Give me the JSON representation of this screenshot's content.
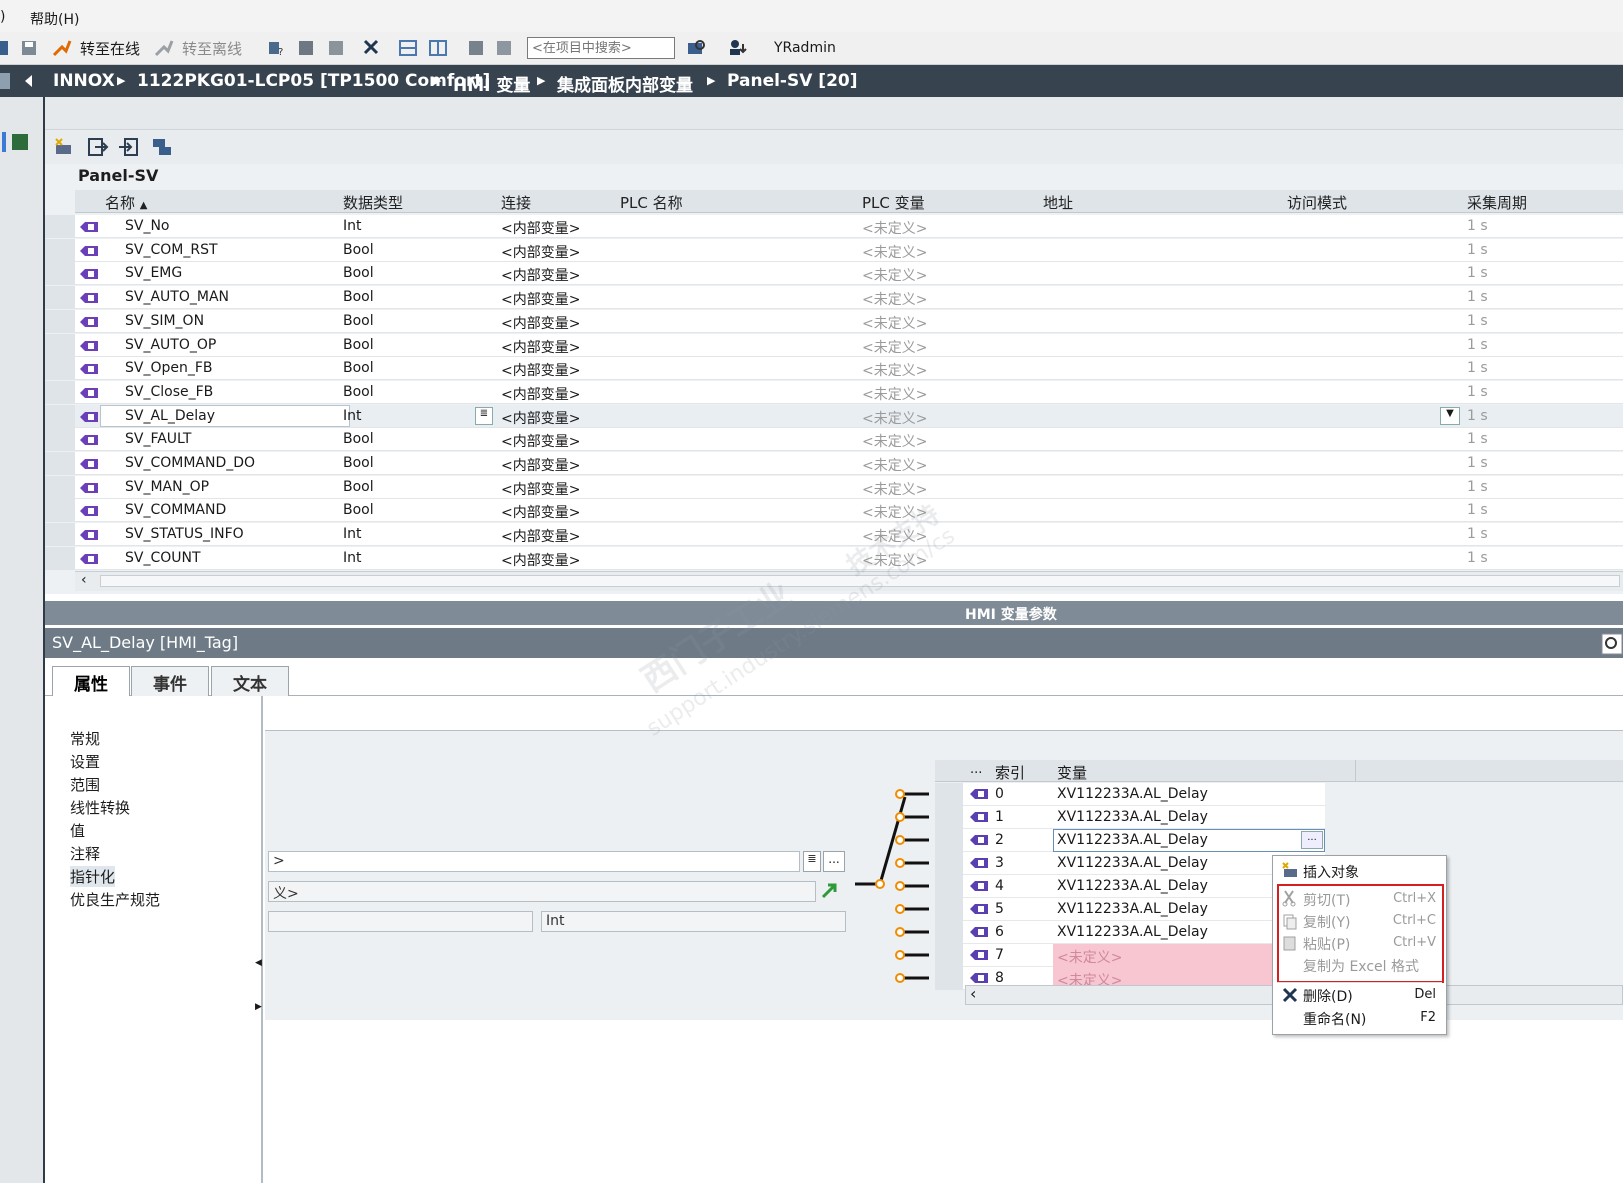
{
  "menubar": {
    "help": "帮助(H)",
    "partial": ")"
  },
  "toolbar": {
    "go_online": "转至在线",
    "go_offline": "转至离线",
    "search_placeholder": "<在项目中搜索>",
    "user": "YRadmin"
  },
  "breadcrumb": [
    "INNOX",
    "1122PKG01-LCP05 [TP1500 Comfort]",
    "HMI 变量",
    "集成面板内部变量",
    "Panel-SV [20]"
  ],
  "table": {
    "title": "Panel-SV",
    "columns": [
      "名称",
      "数据类型",
      "连接",
      "PLC 名称",
      "PLC 变量",
      "地址",
      "访问模式",
      "采集周期"
    ],
    "rows": [
      {
        "name": "SV_No",
        "type": "Int",
        "conn": "<内部变量>",
        "plc_var": "<未定义>",
        "cycle": "1 s"
      },
      {
        "name": "SV_COM_RST",
        "type": "Bool",
        "conn": "<内部变量>",
        "plc_var": "<未定义>",
        "cycle": "1 s"
      },
      {
        "name": "SV_EMG",
        "type": "Bool",
        "conn": "<内部变量>",
        "plc_var": "<未定义>",
        "cycle": "1 s"
      },
      {
        "name": "SV_AUTO_MAN",
        "type": "Bool",
        "conn": "<内部变量>",
        "plc_var": "<未定义>",
        "cycle": "1 s"
      },
      {
        "name": "SV_SIM_ON",
        "type": "Bool",
        "conn": "<内部变量>",
        "plc_var": "<未定义>",
        "cycle": "1 s"
      },
      {
        "name": "SV_AUTO_OP",
        "type": "Bool",
        "conn": "<内部变量>",
        "plc_var": "<未定义>",
        "cycle": "1 s"
      },
      {
        "name": "SV_Open_FB",
        "type": "Bool",
        "conn": "<内部变量>",
        "plc_var": "<未定义>",
        "cycle": "1 s"
      },
      {
        "name": "SV_Close_FB",
        "type": "Bool",
        "conn": "<内部变量>",
        "plc_var": "<未定义>",
        "cycle": "1 s"
      },
      {
        "name": "SV_AL_Delay",
        "type": "Int",
        "conn": "<内部变量>",
        "plc_var": "<未定义>",
        "cycle": "1 s"
      },
      {
        "name": "SV_FAULT",
        "type": "Bool",
        "conn": "<内部变量>",
        "plc_var": "<未定义>",
        "cycle": "1 s"
      },
      {
        "name": "SV_COMMAND_DO",
        "type": "Bool",
        "conn": "<内部变量>",
        "plc_var": "<未定义>",
        "cycle": "1 s"
      },
      {
        "name": "SV_MAN_OP",
        "type": "Bool",
        "conn": "<内部变量>",
        "plc_var": "<未定义>",
        "cycle": "1 s"
      },
      {
        "name": "SV_COMMAND",
        "type": "Bool",
        "conn": "<内部变量>",
        "plc_var": "<未定义>",
        "cycle": "1 s"
      },
      {
        "name": "SV_STATUS_INFO",
        "type": "Int",
        "conn": "<内部变量>",
        "plc_var": "<未定义>",
        "cycle": "1 s"
      },
      {
        "name": "SV_COUNT",
        "type": "Int",
        "conn": "<内部变量>",
        "plc_var": "<未定义>",
        "cycle": "1 s"
      }
    ]
  },
  "params_bar": "HMI 变量参数",
  "inspector": {
    "title": "SV_AL_Delay [HMI_Tag]",
    "tabs": [
      "属性",
      "事件",
      "文本"
    ],
    "nav": [
      "常规",
      "设置",
      "范围",
      "线性转换",
      "值",
      "注释",
      "指针化",
      "优良生产规范"
    ],
    "field1": ">",
    "field2": "义>",
    "field3": "Int"
  },
  "index_list": {
    "headers": [
      "...",
      "索引",
      "变量"
    ],
    "rows": [
      {
        "idx": "0",
        "var": "XV112233A.AL_Delay"
      },
      {
        "idx": "1",
        "var": "XV112233A.AL_Delay"
      },
      {
        "idx": "2",
        "var": "XV112233A.AL_Delay"
      },
      {
        "idx": "3",
        "var": "XV112233A.AL_Delay"
      },
      {
        "idx": "4",
        "var": "XV112233A.AL_Delay"
      },
      {
        "idx": "5",
        "var": "XV112233A.AL_Delay"
      },
      {
        "idx": "6",
        "var": "XV112233A.AL_Delay"
      },
      {
        "idx": "7",
        "var": "<未定义>"
      },
      {
        "idx": "8",
        "var": "<未定义>"
      }
    ],
    "ellipsis_button": "..."
  },
  "context_menu": {
    "insert": "插入对象",
    "cut": "剪切(T)",
    "cut_key": "Ctrl+X",
    "copy": "复制(Y)",
    "copy_key": "Ctrl+C",
    "paste": "粘贴(P)",
    "paste_key": "Ctrl+V",
    "copy_excel": "复制为 Excel 格式",
    "delete": "删除(D)",
    "delete_key": "Del",
    "rename": "重命名(N)",
    "rename_key": "F2"
  },
  "watermark": [
    "西门子工业",
    "技术支持",
    "support.industry.siemens.com/cs"
  ],
  "colors": {
    "breadcrumb_bg": "#37434f",
    "accent_orange": "#f08c00",
    "undefined_pink": "#f7c6d0",
    "highlight_red": "#d42020"
  }
}
